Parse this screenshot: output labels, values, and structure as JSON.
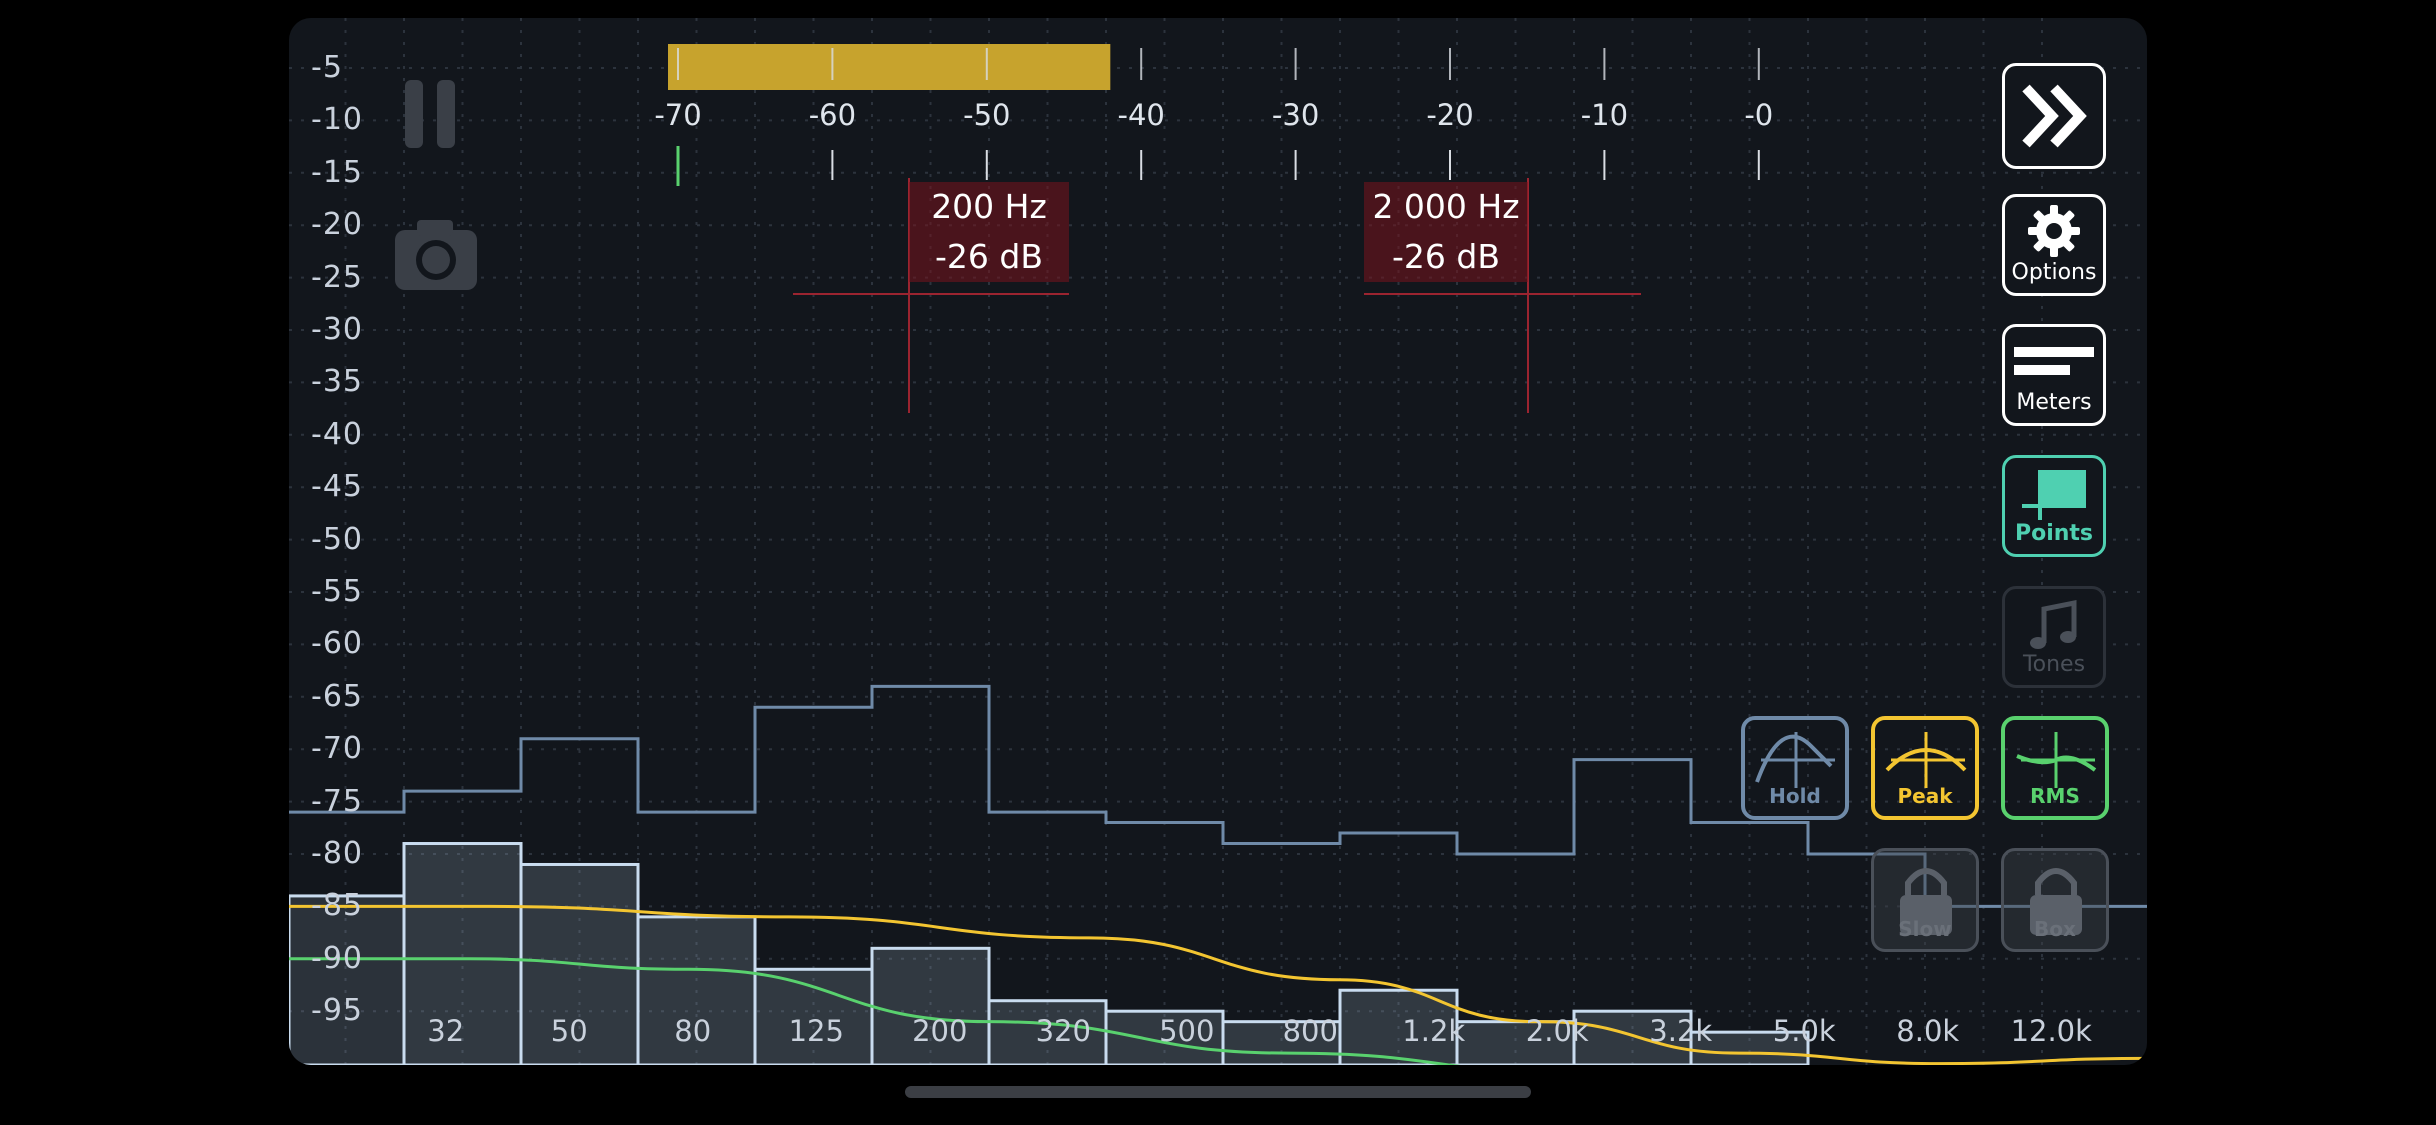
{
  "chart_data": {
    "type": "bar",
    "y_axis_labels": [
      "-5",
      "-10",
      "-15",
      "-20",
      "-25",
      "-30",
      "-35",
      "-40",
      "-45",
      "-50",
      "-55",
      "-60",
      "-65",
      "-70",
      "-75",
      "-80",
      "-85",
      "-90",
      "-95"
    ],
    "x_axis_labels": [
      "32",
      "50",
      "80",
      "125",
      "200",
      "320",
      "500",
      "800",
      "1.2k",
      "2.0k",
      "3.2k",
      "5.0k",
      "8.0k",
      "12.0k"
    ],
    "ylim": [
      -100,
      0
    ],
    "grid": true,
    "series": [
      {
        "values": [
          -79,
          -81,
          -86,
          -91,
          -89,
          -94,
          -95,
          -96,
          -93,
          -96,
          -95,
          -97,
          -102,
          -103
        ]
      },
      {
        "values": [
          -74,
          -69,
          -76,
          -66,
          -64,
          -76,
          -77,
          -79,
          -78,
          -80,
          -71,
          -77,
          -80,
          -85
        ]
      }
    ],
    "level_scale": [
      "-70",
      "-60",
      "-50",
      "-40",
      "-30",
      "-20",
      "-10",
      "-0"
    ],
    "level_fill": -42,
    "level_marker": -70,
    "markers": [
      {
        "freq": "200 Hz",
        "level": "-26 dB"
      },
      {
        "freq": "2 000 Hz",
        "level": "-26 dB"
      }
    ]
  },
  "buttons": {
    "options": "Options",
    "meters": "Meters",
    "points": "Points",
    "tones": "Tones",
    "hold": "Hold",
    "peak": "Peak",
    "rms": "RMS",
    "slow": "Slow",
    "box": "Box"
  },
  "colors": {
    "bars": "#c9dcef",
    "hold": "#6f8aa8",
    "peak": "#f3c531",
    "rms": "#59d16e",
    "level": "#c7a32d",
    "marker": "#9b2430",
    "points": "#4fd0b1"
  }
}
